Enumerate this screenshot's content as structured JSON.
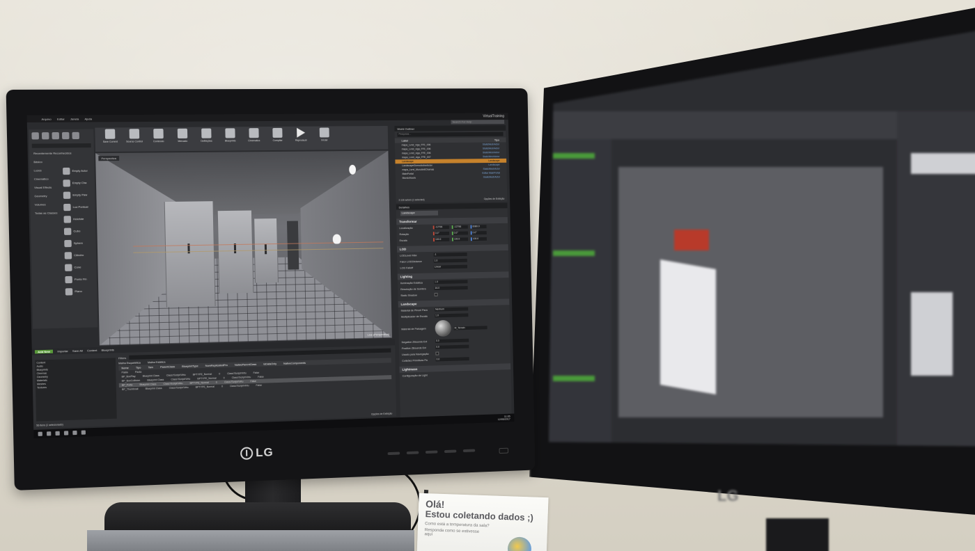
{
  "scene": {
    "left_brand": "LG",
    "right_brand": "LG"
  },
  "editor": {
    "project_name": "VirtualTraining",
    "search_placeholder": "Search For Help",
    "menu": [
      "Arquivo",
      "Editar",
      "Janela",
      "Ajuda"
    ],
    "modes": {
      "categories": [
        "Recentemente Reconhecidos",
        "Básico",
        "Luzes",
        "Cinemático",
        "Visual Effects",
        "Geometry",
        "Volumes",
        "Todas as Classes"
      ],
      "places": [
        "Empty Actor",
        "Empty Cha",
        "Empty Paw",
        "Luz Pontual",
        "Holofote",
        "Cubo",
        "Sphere",
        "Cilindro",
        "Cone",
        "Ponto Fin",
        "Plano"
      ]
    },
    "toolbar": [
      {
        "label": "Save Current"
      },
      {
        "label": "Source Control"
      },
      {
        "label": "Conteúdo"
      },
      {
        "label": "Mercado"
      },
      {
        "label": "Definições"
      },
      {
        "label": "Blueprints"
      },
      {
        "label": "Cinematics"
      },
      {
        "label": "Compilar"
      },
      {
        "label": "Reproduzir"
      },
      {
        "label": "Iniciar"
      }
    ],
    "viewport": {
      "perspective_label": "Perspectiva",
      "lighting_label": "Iluminado",
      "mode_label": "Live (Perspectiva)"
    },
    "outliner": {
      "tab": "World Outliner",
      "search": "Pesquisar...",
      "col_label": "Label",
      "col_type": "Tipo",
      "rows": [
        {
          "label": "mapa_Lvrel_viga_FFE_006",
          "type": "StaticMeshActor",
          "selected": false
        },
        {
          "label": "mapa_Lvrel_viga_FFE_006",
          "type": "StaticMeshActor",
          "selected": false
        },
        {
          "label": "mapa_Lvrel_viga_FFE_006",
          "type": "StaticMeshActor",
          "selected": false
        },
        {
          "label": "mapa_Lvrel_viga_FFE_007",
          "type": "StaticMeshActor",
          "selected": false
        },
        {
          "label": "Landscape",
          "type": "Landscape",
          "selected": true
        },
        {
          "label": "LandscapeGizmoActiveActor",
          "type": "Landscape",
          "selected": false
        },
        {
          "label": "mapa_Lvrel_MuroAntiChamas",
          "type": "StaticMeshActor",
          "selected": false
        },
        {
          "label": "MainPortal",
          "type": "Editar MainPortal",
          "selected": false
        },
        {
          "label": "MundoNoufo",
          "type": "StaticMeshActor",
          "selected": false
        }
      ],
      "footer_count": "2.116 actors (1 selected)",
      "footer_options": "Opções de Exibição"
    },
    "details": {
      "tab": "Detalhes",
      "name": "Landscape",
      "transform_title": "Transformar",
      "location_label": "Localização",
      "rotation_label": "Rotação",
      "scale_label": "Escala",
      "location": [
        "-12796",
        "-12796",
        "6080.0"
      ],
      "rotation": [
        "0.0°",
        "0.0°",
        "0.0°"
      ],
      "scale": [
        "100.0",
        "100.0",
        "100.0"
      ],
      "lod_title": "LOD",
      "lod_rows": [
        {
          "label": "LODLevel Máx",
          "value": "-1"
        },
        {
          "label": "Fator LODDistance",
          "value": "1.0"
        },
        {
          "label": "LOD Falloff",
          "value": "Linear"
        }
      ],
      "lighting_title": "Lighting",
      "lighting_rows": [
        {
          "label": "Iluminação Estática",
          "value": "1.0"
        },
        {
          "label": "Resolução de Sombra",
          "value": "16.0"
        },
        {
          "label": "Static Shadow",
          "value": ""
        }
      ],
      "landscape_title": "Landscape",
      "landscape_rows": [
        {
          "label": "Material de Pincel Para",
          "value": "Nenhum"
        },
        {
          "label": "Multiplicador de Escala",
          "value": "1.0"
        },
        {
          "label": "Material de Paisagem",
          "value": "M_Terrain"
        },
        {
          "label": "Negative ZBounds Ext",
          "value": "0.0"
        },
        {
          "label": "Positive ZBounds Ext",
          "value": "0.0"
        },
        {
          "label": "Usado para Navegação",
          "value": ""
        },
        {
          "label": "Colisões Primitivas Pa",
          "value": "0.0"
        }
      ],
      "lightmass_title": "Lightmass",
      "lightmass_row": "Configuração de Light"
    },
    "content_browser": {
      "add_new": "Add New",
      "import": "Importar",
      "save_all": "Save All",
      "breadcrumb": [
        "Content",
        "Blueprints"
      ],
      "filters": "Filters",
      "tabs": [
        "Malha Esquelética",
        "Malha Estática"
      ],
      "tree": [
        "Content",
        "Audio",
        "Blueprints",
        "Cinemas",
        "Geometry",
        "Materials",
        "Meshes",
        "Textures"
      ],
      "columns": [
        "Nome",
        "Tipo",
        "Tam",
        "ParentClass",
        "BlueprintType",
        "NumReplicatedPro",
        "NativeParentClass",
        "IsDataOnly",
        "NativeComponents"
      ],
      "rows": [
        [
          "Pasta",
          "Pasta",
          "",
          "",
          "",
          "",
          "",
          "",
          ""
        ],
        [
          "BP_BoxPlay",
          "Blueprint Class",
          "",
          "Class'/Script/Virtu",
          "BPTYPE_Normal",
          "0",
          "Class'/Script/Virtu",
          "False",
          ""
        ],
        [
          "BP_BoxCollision",
          "Blueprint Class",
          "",
          "Class'/Script/Virtu",
          "BPTYPE_Normal",
          "0",
          "Class'/Script/Virtu",
          "False",
          ""
        ],
        [
          "BP_Porta",
          "Blueprint Class",
          "",
          "Class'/Script/Virtu",
          "BPTYPE_Normal",
          "0",
          "Class'/Script/Virtu",
          "False",
          ""
        ],
        [
          "BP_Thumbnail",
          "Blueprint Class",
          "",
          "Class'/Script/Virtu",
          "BPTYPE_Normal",
          "0",
          "Class'/Script/Virtu",
          "False",
          ""
        ]
      ],
      "footer_count": "56 itens (1 selecionado)",
      "footer_options": "Opções de Exibição"
    },
    "taskbar": {
      "time": "11:05",
      "date": "12/05/2017"
    }
  },
  "sign": {
    "line1": "Olá!",
    "line2": "Estou coletando dados ;)",
    "line3": "Como está a temperatura da sala?",
    "line4": "Responda como se estivesse aqui"
  }
}
